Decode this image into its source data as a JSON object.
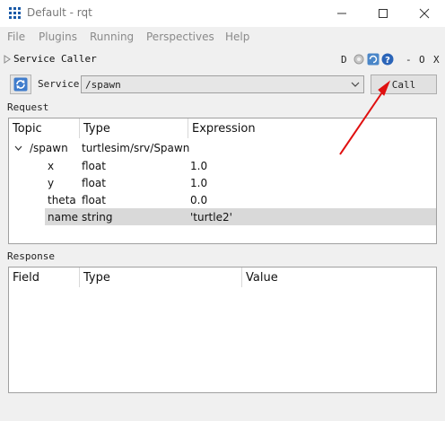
{
  "window": {
    "title": "Default - rqt",
    "controls": {
      "minimize": "—",
      "maximize": "☐",
      "close": "✕"
    }
  },
  "menu": [
    "File",
    "Plugins",
    "Running",
    "Perspectives",
    "Help"
  ],
  "plugin": {
    "title": "Service Caller",
    "header_buttons": {
      "d": "D",
      "minus": "-",
      "o": "O",
      "x": "X"
    }
  },
  "service": {
    "label": "Service",
    "value": "/spawn",
    "call_label": "Call"
  },
  "request": {
    "label": "Request",
    "headers": [
      "Topic",
      "Type",
      "Expression"
    ],
    "root": {
      "topic": "/spawn",
      "type": "turtlesim/srv/Spawn",
      "expression": ""
    },
    "rows": [
      {
        "topic": "x",
        "type": "float",
        "expression": "1.0"
      },
      {
        "topic": "y",
        "type": "float",
        "expression": "1.0"
      },
      {
        "topic": "theta",
        "type": "float",
        "expression": "0.0"
      },
      {
        "topic": "name",
        "type": "string",
        "expression": "'turtle2'"
      }
    ]
  },
  "response": {
    "label": "Response",
    "headers": [
      "Field",
      "Type",
      "Value"
    ]
  },
  "colors": {
    "annotation_arrow": "#e01010",
    "selected_row": "#d9d9d9",
    "icon_blue": "#1a5aa8"
  },
  "icons": [
    "rqt-app-icon",
    "collapse-triangle-icon",
    "gear-icon",
    "refresh-icon",
    "help-icon",
    "chevron-down-icon",
    "expand-arrow-icon",
    "red-arrow-annotation"
  ]
}
